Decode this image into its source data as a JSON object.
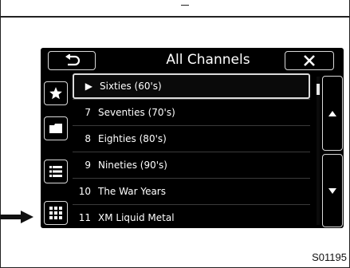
{
  "header": {
    "title": "All Channels",
    "back_icon": "back-arrow-icon",
    "close_icon": "close-icon"
  },
  "side_buttons": [
    {
      "icon": "star-icon"
    },
    {
      "icon": "folder-icon"
    },
    {
      "icon": "list-icon"
    },
    {
      "icon": "grid-icon"
    }
  ],
  "channels": [
    {
      "number": "▶",
      "name": "Sixties (60's)",
      "selected": true
    },
    {
      "number": "7",
      "name": "Seventies (70's)"
    },
    {
      "number": "8",
      "name": "Eighties (80's)"
    },
    {
      "number": "9",
      "name": "Nineties (90's)"
    },
    {
      "number": "10",
      "name": "The War Years"
    },
    {
      "number": "11",
      "name": "XM Liquid Metal"
    }
  ],
  "scroll_buttons": {
    "up_icon": "triangle-up-icon",
    "down_icon": "triangle-down-icon"
  },
  "pointer_arrow_icon": "pointer-arrow-icon",
  "caption": "S01195"
}
